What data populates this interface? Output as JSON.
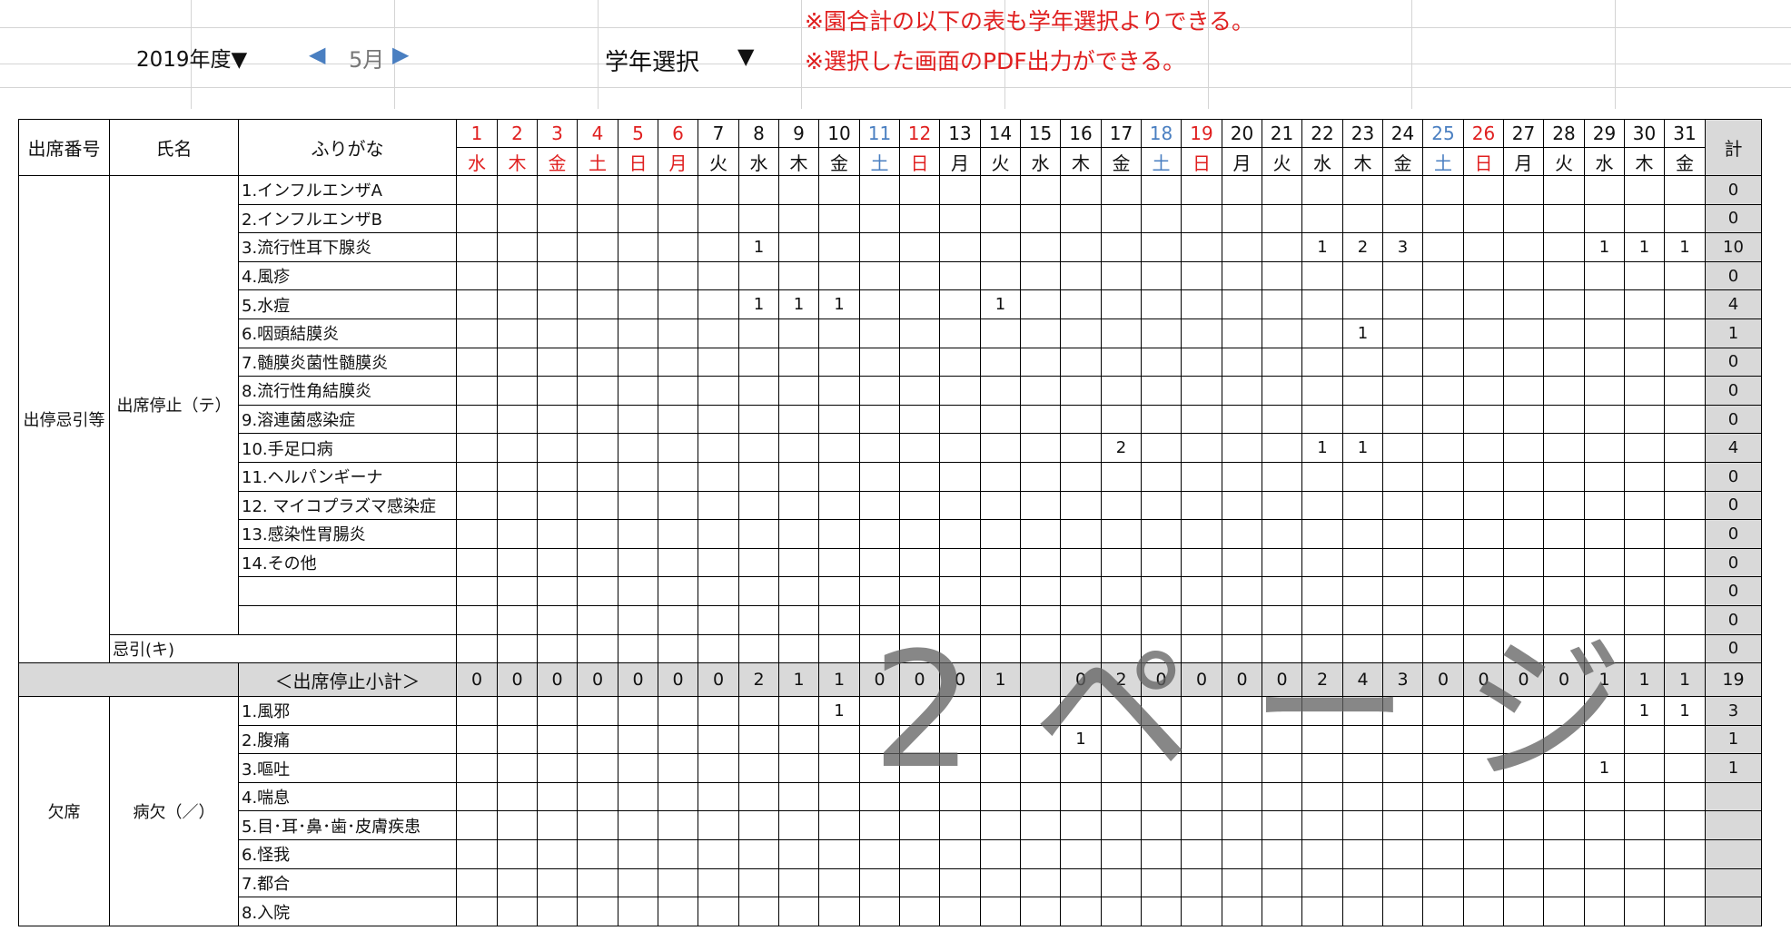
{
  "controls": {
    "year_label": "2019年度▼",
    "prev_arrow": "◀",
    "month_label": "5月",
    "next_arrow": "▶",
    "grade_label": "学年選択",
    "grade_arrow": "▼"
  },
  "notes": [
    "※園合計の以下の表も学年選択よりできる。",
    "※選択した画面のPDF出力ができる。"
  ],
  "colors": {
    "red": "#e02020",
    "blue": "#4a7fc1",
    "grey": "#d9d9d9"
  },
  "table": {
    "header": {
      "number": "出席番号",
      "name": "氏名",
      "furigana": "ふりがな",
      "total": "計"
    },
    "days": [
      "1",
      "2",
      "3",
      "4",
      "5",
      "6",
      "7",
      "8",
      "9",
      "10",
      "11",
      "12",
      "13",
      "14",
      "15",
      "16",
      "17",
      "18",
      "19",
      "20",
      "21",
      "22",
      "23",
      "24",
      "25",
      "26",
      "27",
      "28",
      "29",
      "30",
      "31"
    ],
    "weekdays": [
      "水",
      "木",
      "金",
      "土",
      "日",
      "月",
      "火",
      "水",
      "木",
      "金",
      "土",
      "日",
      "月",
      "火",
      "水",
      "木",
      "金",
      "土",
      "日",
      "月",
      "火",
      "水",
      "木",
      "金",
      "土",
      "日",
      "月",
      "火",
      "水",
      "木",
      "金"
    ],
    "day_colors": [
      "red",
      "red",
      "red",
      "red",
      "red",
      "red",
      "",
      "",
      "",
      "",
      "blue",
      "red",
      "",
      "",
      "",
      "",
      "",
      "blue",
      "red",
      "",
      "",
      "",
      "",
      "",
      "blue",
      "red",
      "",
      "",
      "",
      "",
      ""
    ],
    "section1": {
      "label": "出停忌引等",
      "sub_label": "出席停止（テ）",
      "rows": [
        {
          "name": "1.インフルエンザA",
          "cells": {},
          "total": "0"
        },
        {
          "name": "2.インフルエンザB",
          "cells": {},
          "total": "0"
        },
        {
          "name": "3.流行性耳下腺炎",
          "cells": {
            "8": "1",
            "22": "1",
            "23": "2",
            "24": "3",
            "29": "1",
            "30": "1",
            "31": "1"
          },
          "total": "10"
        },
        {
          "name": "4.風疹",
          "cells": {},
          "total": "0"
        },
        {
          "name": "5.水痘",
          "cells": {
            "8": "1",
            "9": "1",
            "10": "1",
            "14": "1"
          },
          "total": "4"
        },
        {
          "name": "6.咽頭結膜炎",
          "cells": {
            "23": "1"
          },
          "total": "1"
        },
        {
          "name": "7.髄膜炎菌性髄膜炎",
          "cells": {},
          "total": "0"
        },
        {
          "name": "8.流行性角結膜炎",
          "cells": {},
          "total": "0"
        },
        {
          "name": "9.溶連菌感染症",
          "cells": {},
          "total": "0"
        },
        {
          "name": "10.手足口病",
          "cells": {
            "17": "2",
            "22": "1",
            "23": "1"
          },
          "total": "4"
        },
        {
          "name": "11.ヘルパンギーナ",
          "cells": {},
          "total": "0"
        },
        {
          "name": "12. マイコプラズマ感染症",
          "cells": {},
          "total": "0"
        },
        {
          "name": "13.感染性胃腸炎",
          "cells": {},
          "total": "0"
        },
        {
          "name": "14.その他",
          "cells": {},
          "total": "0"
        },
        {
          "name": "",
          "cells": {},
          "total": "0"
        },
        {
          "name": "",
          "cells": {},
          "total": "0"
        }
      ],
      "bereavement": {
        "name": "忌引(キ)",
        "total": "0"
      },
      "subtotal": {
        "label": "＜出席停止小計＞",
        "values": [
          "0",
          "0",
          "0",
          "0",
          "0",
          "0",
          "0",
          "2",
          "1",
          "1",
          "0",
          "0",
          "0",
          "1",
          "",
          "0",
          "2",
          "0",
          "0",
          "0",
          "0",
          "2",
          "4",
          "3",
          "0",
          "0",
          "0",
          "0",
          "1",
          "1",
          "1"
        ],
        "total": "19"
      }
    },
    "section2": {
      "label": "欠席",
      "sub_label": "病欠（／）",
      "rows": [
        {
          "name": "1.風邪",
          "cells": {
            "10": "1",
            "30": "1",
            "31": "1"
          },
          "total": "3"
        },
        {
          "name": "2.腹痛",
          "cells": {
            "16": "1"
          },
          "total": "1"
        },
        {
          "name": "3.嘔吐",
          "cells": {
            "29": "1"
          },
          "total": "1"
        },
        {
          "name": "4.喘息",
          "cells": {},
          "total": ""
        },
        {
          "name": "5.目･耳･鼻･歯･皮膚疾患",
          "cells": {},
          "total": ""
        },
        {
          "name": "6.怪我",
          "cells": {},
          "total": ""
        },
        {
          "name": "7.都合",
          "cells": {},
          "total": ""
        },
        {
          "name": "8.入院",
          "cells": {},
          "total": ""
        }
      ]
    }
  },
  "watermark": "2ページ"
}
